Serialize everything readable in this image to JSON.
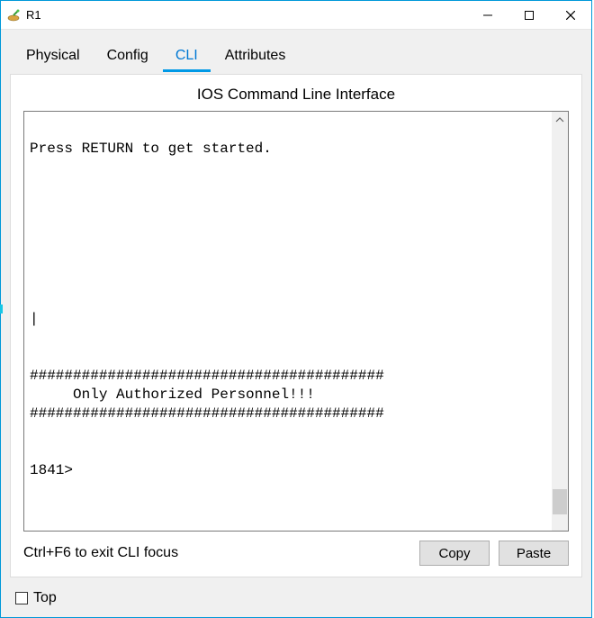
{
  "window": {
    "title": "R1"
  },
  "tabs": [
    {
      "label": "Physical",
      "active": false
    },
    {
      "label": "Config",
      "active": false
    },
    {
      "label": "CLI",
      "active": true
    },
    {
      "label": "Attributes",
      "active": false
    }
  ],
  "panel": {
    "title": "IOS Command Line Interface",
    "terminal_text": "\nPress RETURN to get started.\n\n\n\n\n\n\n\n\n|\n\n\n#########################################\n     Only Authorized Personnel!!!\n#########################################\n\n\n1841>",
    "hint": "Ctrl+F6 to exit CLI focus",
    "copy_label": "Copy",
    "paste_label": "Paste"
  },
  "footer": {
    "top_label": "Top",
    "top_checked": false
  }
}
